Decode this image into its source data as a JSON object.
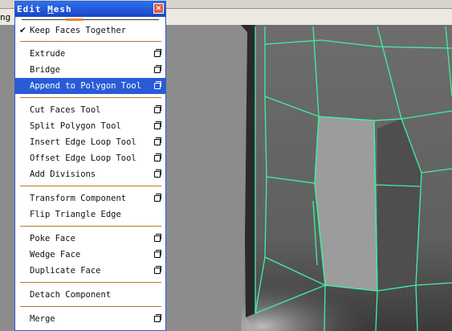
{
  "background": {
    "left_fragment": "ng"
  },
  "menu": {
    "title_first_letter": "E",
    "title_rest1": "dit ",
    "title_underlined": "M",
    "title_rest2": "esh",
    "close_glyph": "×",
    "highlight_color": "#2a5bd6",
    "groups": [
      {
        "items": [
          {
            "label": "Keep Faces Together",
            "checked": true,
            "option": false
          }
        ]
      },
      {
        "items": [
          {
            "label": "Extrude",
            "option": true
          },
          {
            "label": "Bridge",
            "option": true
          },
          {
            "label": "Append to Polygon Tool",
            "option": true,
            "highlighted": true
          }
        ]
      },
      {
        "items": [
          {
            "label": "Cut Faces Tool",
            "option": true
          },
          {
            "label": "Split Polygon Tool",
            "option": true
          },
          {
            "label": "Insert Edge Loop Tool",
            "option": true
          },
          {
            "label": "Offset Edge Loop Tool",
            "option": true
          },
          {
            "label": "Add Divisions",
            "option": true
          }
        ]
      },
      {
        "items": [
          {
            "label": "Transform Component",
            "option": true
          },
          {
            "label": "Flip Triangle Edge",
            "option": false
          }
        ]
      },
      {
        "items": [
          {
            "label": "Poke Face",
            "option": true
          },
          {
            "label": "Wedge Face",
            "option": true
          },
          {
            "label": "Duplicate Face",
            "option": true
          }
        ]
      },
      {
        "items": [
          {
            "label": "Detach Component",
            "option": false
          }
        ]
      },
      {
        "items": [
          {
            "label": "Merge",
            "option": true
          }
        ]
      }
    ]
  },
  "viewport": {
    "wire_color": "#3ff2a0"
  }
}
